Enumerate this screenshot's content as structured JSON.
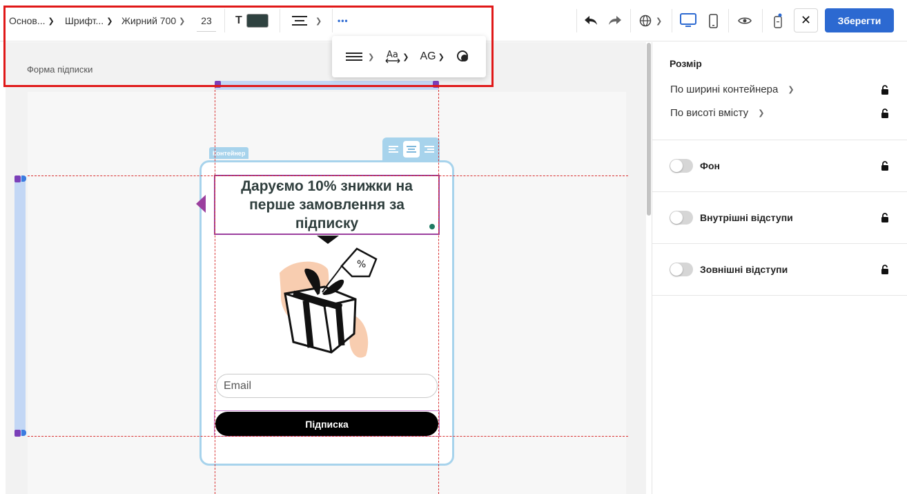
{
  "toolbar": {
    "style_select": "Основ...",
    "font_select": "Шрифт...",
    "weight_select": "Жирний 700",
    "font_size": "23",
    "text_color_label": "T",
    "text_color": "#2f4240",
    "more_label": "•••",
    "save_label": "Зберегти",
    "close_label": "✕"
  },
  "popup": {
    "case_label": "AG"
  },
  "canvas": {
    "page_label": "Форма підписки",
    "container_tag": "Контейнер"
  },
  "form": {
    "headline": "Даруємо 10% знижки на перше замовлення за підписку",
    "email_placeholder": "Email",
    "subscribe_label": "Підписка"
  },
  "panel": {
    "size_title": "Розмір",
    "width_option": "По ширині контейнера",
    "height_option": "По висоті вмісту",
    "background_label": "Фон",
    "padding_label": "Внутрішні відступи",
    "margin_label": "Зовнішні відступи"
  }
}
